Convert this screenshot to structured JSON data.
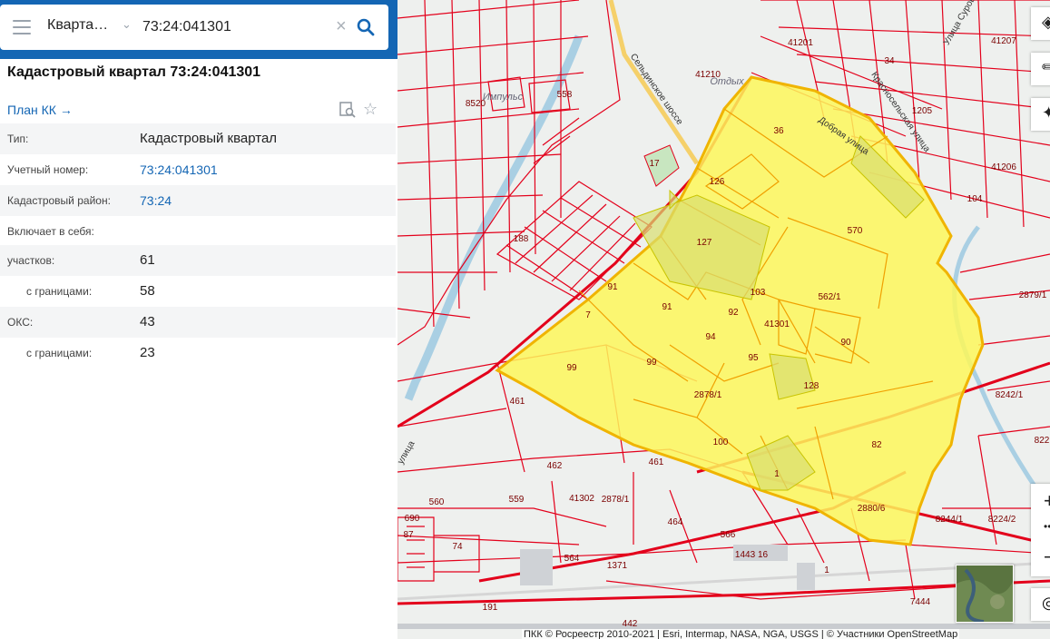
{
  "search": {
    "type_label": "Кварта…",
    "query": "73:24:041301"
  },
  "details": {
    "title": "Кадастровый квартал 73:24:041301",
    "plan_link": "План КК",
    "rows": [
      {
        "key": "Тип:",
        "value": "Кадастровый квартал"
      },
      {
        "key": "Учетный номер:",
        "value": "73:24:041301"
      },
      {
        "key": "Кадастровый район:",
        "value": "73:24"
      },
      {
        "key": "Включает в себя:",
        "value": ""
      },
      {
        "key": "участков:",
        "value": "61"
      },
      {
        "key": "с границами:",
        "value": "58"
      },
      {
        "key": "ОКС:",
        "value": "43"
      },
      {
        "key": "с границами:",
        "value": "23"
      }
    ]
  },
  "map": {
    "parcel_labels": [
      "36",
      "126",
      "127",
      "570",
      "91",
      "91",
      "103",
      "562/1",
      "92",
      "41301",
      "7",
      "94",
      "90",
      "99",
      "99",
      "95",
      "128",
      "2878/1",
      "100",
      "82",
      "1",
      "2880/6",
      "461",
      "462",
      "41302",
      "559",
      "560",
      "2878/1",
      "461",
      "464",
      "566",
      "564",
      "1443 16",
      "1371",
      "1",
      "7444",
      "191",
      "442",
      "8242/1",
      "8244/1",
      "8224/2",
      "2879/1",
      "822",
      "104",
      "41206",
      "41207",
      "1205",
      "41201",
      "41210",
      "8520",
      "558",
      "17",
      "188",
      "690",
      "74",
      "87",
      "34"
    ],
    "place_labels": [
      "Импульс",
      "Отдых"
    ],
    "street_labels": [
      "Сельдинское шоссе",
      "Добрая улица",
      "Красносельская улица",
      "Улица Сурова",
      "улица"
    ],
    "attribution": "ПКК © Росреестр 2010-2021 | Esri, Intermap, NASA, NGA, USGS | © Участники OpenStreetMap",
    "colors": {
      "parcel_line": "#e3001b",
      "quarter_fill": "#fdf75b",
      "quarter_line": "#f0b400",
      "background": "#eef0ee"
    }
  }
}
